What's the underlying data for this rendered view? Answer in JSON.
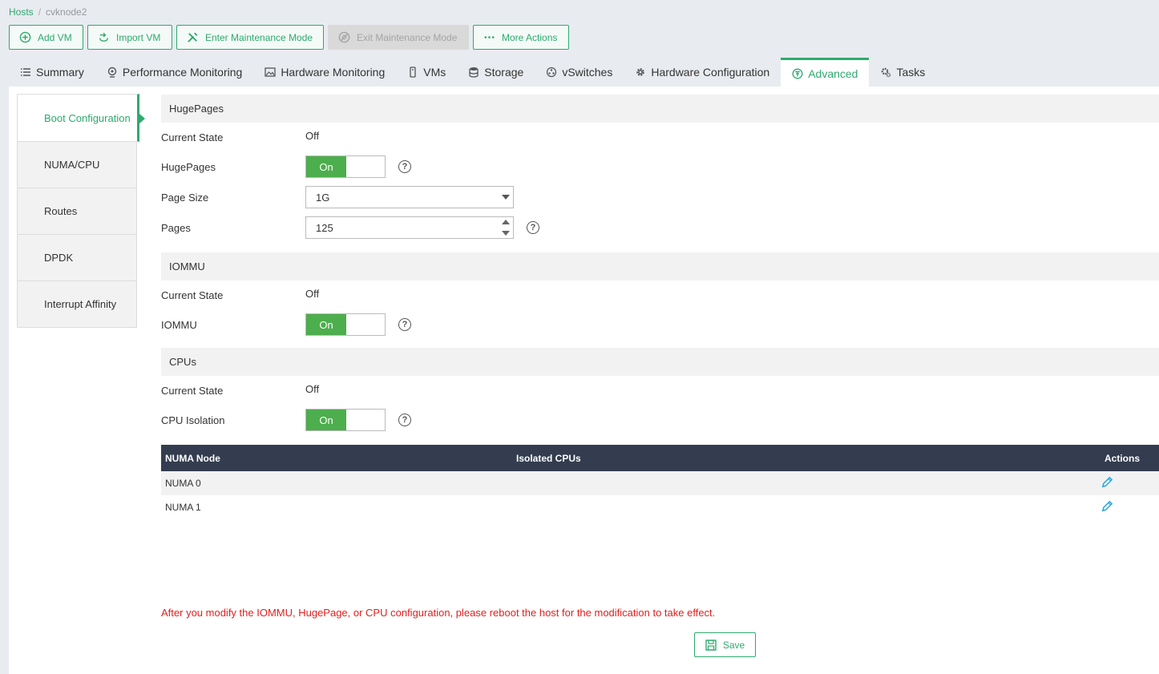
{
  "breadcrumb": {
    "root": "Hosts",
    "sep": "/",
    "current": "cvknode2"
  },
  "toolbar": {
    "add_vm": "Add VM",
    "import_vm": "Import VM",
    "enter_maintenance": "Enter Maintenance Mode",
    "exit_maintenance": "Exit Maintenance Mode",
    "more_actions": "More Actions"
  },
  "tabs": [
    {
      "label": "Summary",
      "icon": "list-icon"
    },
    {
      "label": "Performance Monitoring",
      "icon": "monitor-icon"
    },
    {
      "label": "Hardware Monitoring",
      "icon": "image-icon"
    },
    {
      "label": "VMs",
      "icon": "vm-icon"
    },
    {
      "label": "Storage",
      "icon": "database-icon"
    },
    {
      "label": "vSwitches",
      "icon": "network-icon"
    },
    {
      "label": "Hardware Configuration",
      "icon": "gear-icon"
    },
    {
      "label": "Advanced",
      "icon": "advanced-icon",
      "active": true
    },
    {
      "label": "Tasks",
      "icon": "tasks-icon"
    }
  ],
  "sidenav": [
    {
      "label": "Boot Configuration",
      "active": true
    },
    {
      "label": "NUMA/CPU"
    },
    {
      "label": "Routes"
    },
    {
      "label": "DPDK"
    },
    {
      "label": "Interrupt Affinity"
    }
  ],
  "hugepages": {
    "title": "HugePages",
    "current_state_label": "Current State",
    "current_state_value": "Off",
    "toggle_label": "HugePages",
    "toggle_value": "On",
    "page_size_label": "Page Size",
    "page_size_value": "1G",
    "pages_label": "Pages",
    "pages_value": "125"
  },
  "iommu": {
    "title": "IOMMU",
    "current_state_label": "Current State",
    "current_state_value": "Off",
    "toggle_label": "IOMMU",
    "toggle_value": "On"
  },
  "cpus": {
    "title": "CPUs",
    "current_state_label": "Current State",
    "current_state_value": "Off",
    "toggle_label": "CPU Isolation",
    "toggle_value": "On",
    "table": {
      "headers": {
        "numa": "NUMA Node",
        "isolated": "Isolated CPUs",
        "actions": "Actions"
      },
      "rows": [
        {
          "numa": "NUMA 0",
          "isolated": ""
        },
        {
          "numa": "NUMA 1",
          "isolated": ""
        }
      ]
    }
  },
  "help_glyph": "?",
  "notice": "After you modify the IOMMU, HugePage, or CPU configuration, please reboot the host for the modification to take effect.",
  "save_label": "Save",
  "colors": {
    "accent": "#2eaa6e",
    "toggle_on": "#4cae4c",
    "table_header": "#333d4f",
    "notice": "#e02020",
    "edit_icon": "#29a9e0"
  }
}
